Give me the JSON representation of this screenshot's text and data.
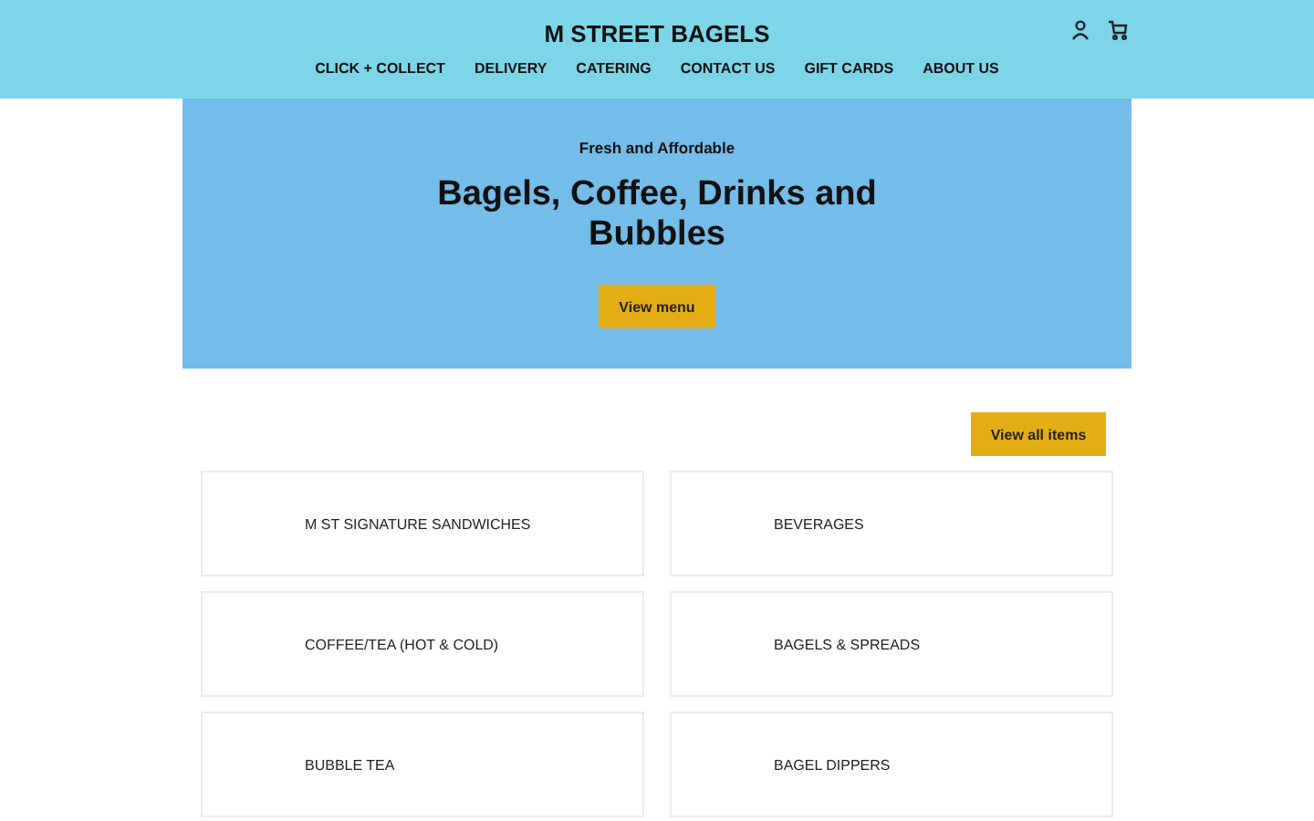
{
  "header": {
    "title": "M STREET BAGELS",
    "nav": [
      "CLICK + COLLECT",
      "DELIVERY",
      "CATERING",
      "CONTACT US",
      "GIFT CARDS",
      "ABOUT US"
    ]
  },
  "hero": {
    "eyebrow": "Fresh and Affordable",
    "heading": "Bagels, Coffee, Drinks and Bubbles",
    "button": "View menu"
  },
  "view_all": "View all items",
  "categories": [
    "M ST SIGNATURE SANDWICHES",
    "BEVERAGES",
    "COFFEE/TEA (HOT & COLD)",
    "BAGELS & SPREADS",
    "BUBBLE TEA",
    "BAGEL DIPPERS"
  ]
}
